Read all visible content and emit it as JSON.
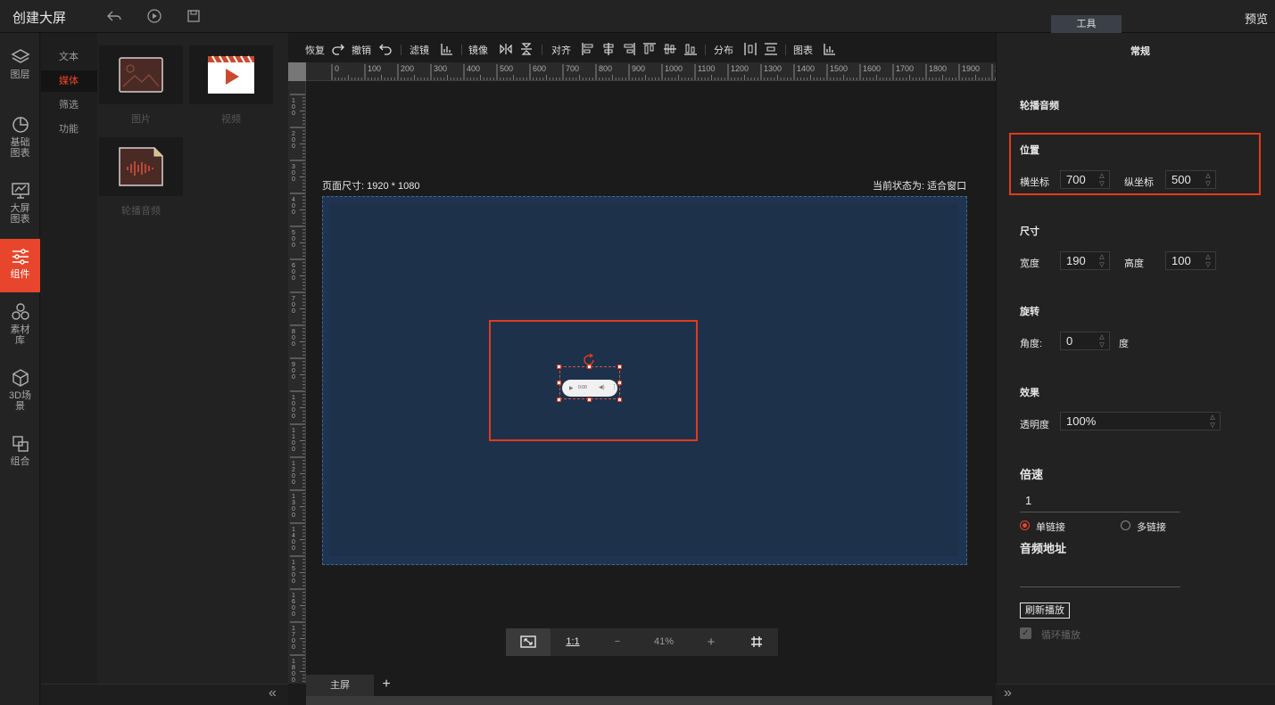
{
  "app": {
    "title": "创建大屏",
    "preview": "预览",
    "tools_tab": "工具"
  },
  "top_icons": [
    "undo-icon",
    "play-icon",
    "save-icon"
  ],
  "left_nav": [
    {
      "label": "图层",
      "icon": "layers-icon",
      "active": false
    },
    {
      "label": "基础图表",
      "icon": "pie-chart-icon",
      "active": false
    },
    {
      "label": "大屏图表",
      "icon": "monitor-chart-icon",
      "active": false
    },
    {
      "label": "组件",
      "icon": "sliders-icon",
      "active": true
    },
    {
      "label": "素材库",
      "icon": "hexagons-icon",
      "active": false
    },
    {
      "label": "3D场景",
      "icon": "cube-icon",
      "active": false
    },
    {
      "label": "组合",
      "icon": "combine-icon",
      "active": false
    }
  ],
  "sub_nav": [
    {
      "label": "文本",
      "active": false
    },
    {
      "label": "媒体",
      "active": true
    },
    {
      "label": "筛选",
      "active": false
    },
    {
      "label": "功能",
      "active": false
    }
  ],
  "assets": [
    {
      "label": "图片",
      "icon": "image-icon"
    },
    {
      "label": "视频",
      "icon": "video-icon"
    },
    {
      "label": "轮播音频",
      "icon": "audio-icon"
    }
  ],
  "toolbar": {
    "redo": "恢复",
    "undo": "撤销",
    "filter": "滤镜",
    "mirror": "镜像",
    "align": "对齐",
    "distribute": "分布",
    "chart": "图表"
  },
  "ruler_top_labels": [
    "0",
    "100",
    "200",
    "300",
    "400",
    "500",
    "600",
    "700",
    "800",
    "900",
    "1000",
    "1100",
    "1200",
    "1300",
    "1400",
    "1500",
    "1600",
    "1700",
    "1800",
    "1900",
    "20"
  ],
  "ruler_left_labels": [
    "1 0 0",
    "2 0 0",
    "3 0 0",
    "4 0 0",
    "5 0 0",
    "6 0 0",
    "7 0 0",
    "8 0 0",
    "9 0 0",
    "1 0 0 0",
    "1 1 0 0",
    "1 2 0 0",
    "1 3 0 0",
    "1 4 0 0",
    "1 5 0 0",
    "1 6 0 0",
    "1 7 0 0",
    "1 8 0 0"
  ],
  "canvas": {
    "page_size": "页面尺寸: 1920 * 1080",
    "status": "当前状态为: 适合窗口",
    "player_time": "0:00"
  },
  "zoom": {
    "fit_icon": "fit-screen-icon",
    "one_to_one": "1:1",
    "minus": "−",
    "level": "41%",
    "plus": "+",
    "grid_icon": "grid-icon"
  },
  "tabs": {
    "main": "主屏",
    "add": "+"
  },
  "props": {
    "section_general": "常规",
    "component_name": "轮播音频",
    "position": {
      "title": "位置",
      "x_label": "横坐标",
      "x_value": "700",
      "y_label": "纵坐标",
      "y_value": "500"
    },
    "size": {
      "title": "尺寸",
      "w_label": "宽度",
      "w_value": "190",
      "h_label": "高度",
      "h_value": "100"
    },
    "rotation": {
      "title": "旋转",
      "angle_label": "角度:",
      "angle_value": "0",
      "unit": "度"
    },
    "effect": {
      "title": "效果",
      "opacity_label": "透明度",
      "opacity_value": "100%"
    },
    "speed": {
      "title": "倍速",
      "value": "1"
    },
    "link": {
      "single": "单链接",
      "multi": "多链接",
      "selected": "single"
    },
    "audio_url": {
      "title": "音频地址",
      "value": ""
    },
    "refresh_button": "刷新播放",
    "loop_label": "循环播放"
  },
  "colors": {
    "accent": "#e8462c",
    "highlight_box": "#e33a1d",
    "canvas_bg": "#1f3450"
  }
}
